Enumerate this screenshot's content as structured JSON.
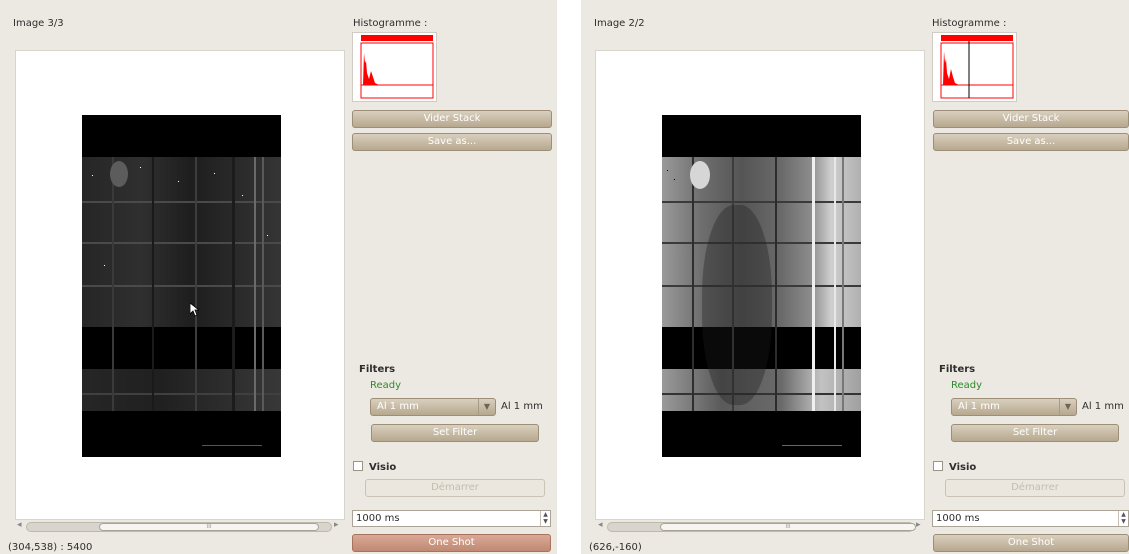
{
  "panels": [
    {
      "image_label": "Image 3/3",
      "histogram_label": "Histogramme :",
      "buttons": {
        "vider_stack": "Vider Stack",
        "save_as": "Save as...",
        "set_filter": "Set Filter",
        "demarrer": "Démarrer",
        "one_shot": "One Shot"
      },
      "filters": {
        "title": "Filters",
        "status": "Ready",
        "selected": "Al 1 mm",
        "current": "Al 1 mm"
      },
      "visio": {
        "label": "Visio",
        "checked": false
      },
      "exposure": "1000 ms",
      "coordinates": "(304,538) : 5400",
      "scroll_thumb_label": "III"
    },
    {
      "image_label": "Image 2/2",
      "histogram_label": "Histogramme :",
      "buttons": {
        "vider_stack": "Vider Stack",
        "save_as": "Save as...",
        "set_filter": "Set Filter",
        "demarrer": "Démarrer",
        "one_shot": "One Shot"
      },
      "filters": {
        "title": "Filters",
        "status": "Ready",
        "selected": "Al 1 mm",
        "current": "Al 1 mm"
      },
      "visio": {
        "label": "Visio",
        "checked": false
      },
      "exposure": "1000 ms",
      "coordinates": "(626,-160)",
      "scroll_thumb_label": "III"
    }
  ],
  "colors": {
    "histogram": "#ff0000",
    "status_ready": "#2d8a2d",
    "button": "#b7a88f",
    "one_shot_active": "#c08a73"
  },
  "icons": {
    "checkbox": "checkbox-unchecked-icon",
    "dropdown": "chevron-down-icon",
    "spin": "spin-arrows-icon",
    "scroll_left": "scroll-left-icon",
    "scroll_right": "scroll-right-icon",
    "cursor": "mouse-pointer-icon"
  }
}
